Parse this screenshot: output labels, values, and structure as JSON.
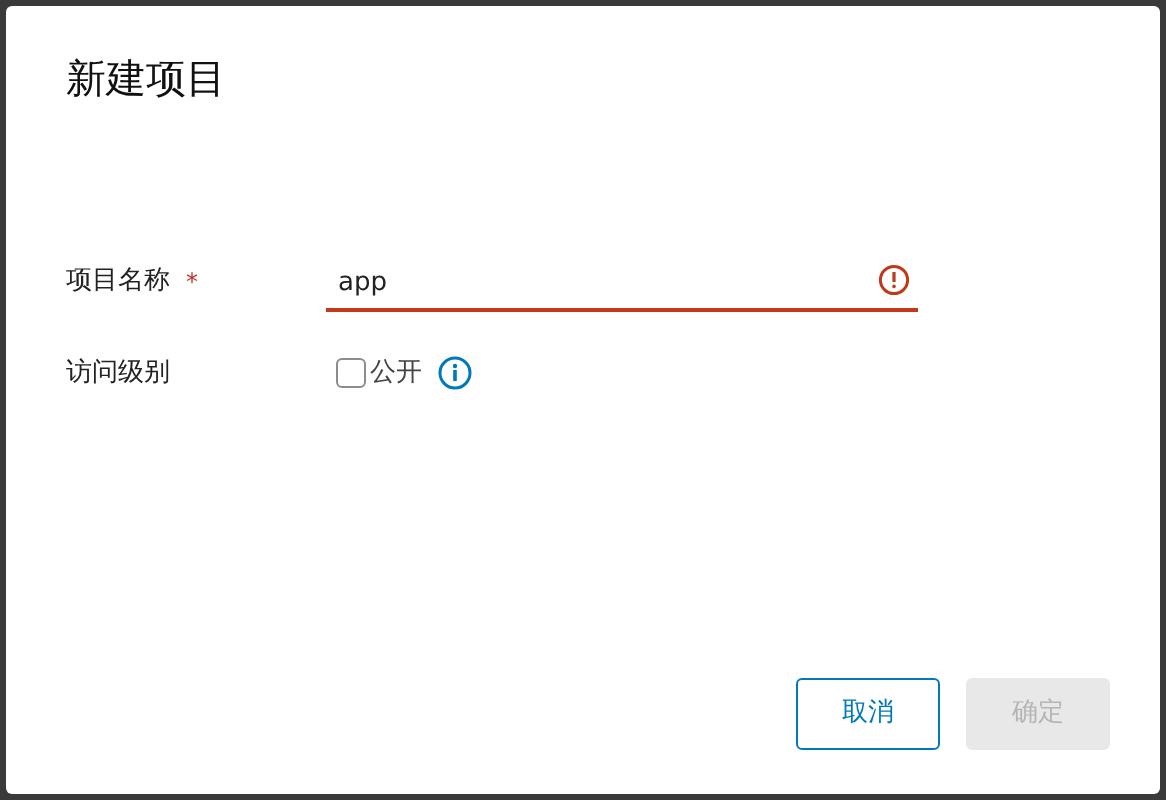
{
  "dialog": {
    "title": "新建项目"
  },
  "name_field": {
    "label": "项目名称",
    "required_mark": "*",
    "value": "app",
    "invalid": true
  },
  "access_field": {
    "label": "访问级别",
    "checkbox_label": "公开",
    "checked": false
  },
  "buttons": [
    {
      "label": "取消",
      "kind": "outline",
      "disabled": false
    },
    {
      "label": "确定",
      "kind": "primary",
      "disabled": true
    }
  ]
}
